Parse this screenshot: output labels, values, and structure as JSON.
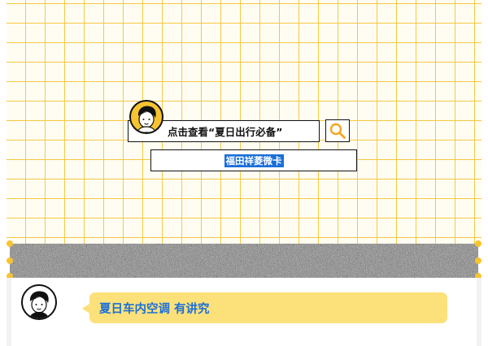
{
  "search": {
    "prompt_text": "点击查看“夏日出行必备”"
  },
  "result": {
    "selected_text": "福田祥菱微卡"
  },
  "chat": {
    "message": "夏日车内空调 有讲究"
  },
  "icons": {
    "search_button": "magnifier-icon",
    "top_avatar": "cartoon-person-avatar",
    "chat_avatar": "cartoon-person-avatar"
  },
  "colors": {
    "grid_line": "#f5c842",
    "accent_yellow": "#f6c431",
    "bubble_yellow": "#fce17a",
    "text_blue": "#1a6fd8",
    "selection_blue": "#1a6fd8"
  }
}
